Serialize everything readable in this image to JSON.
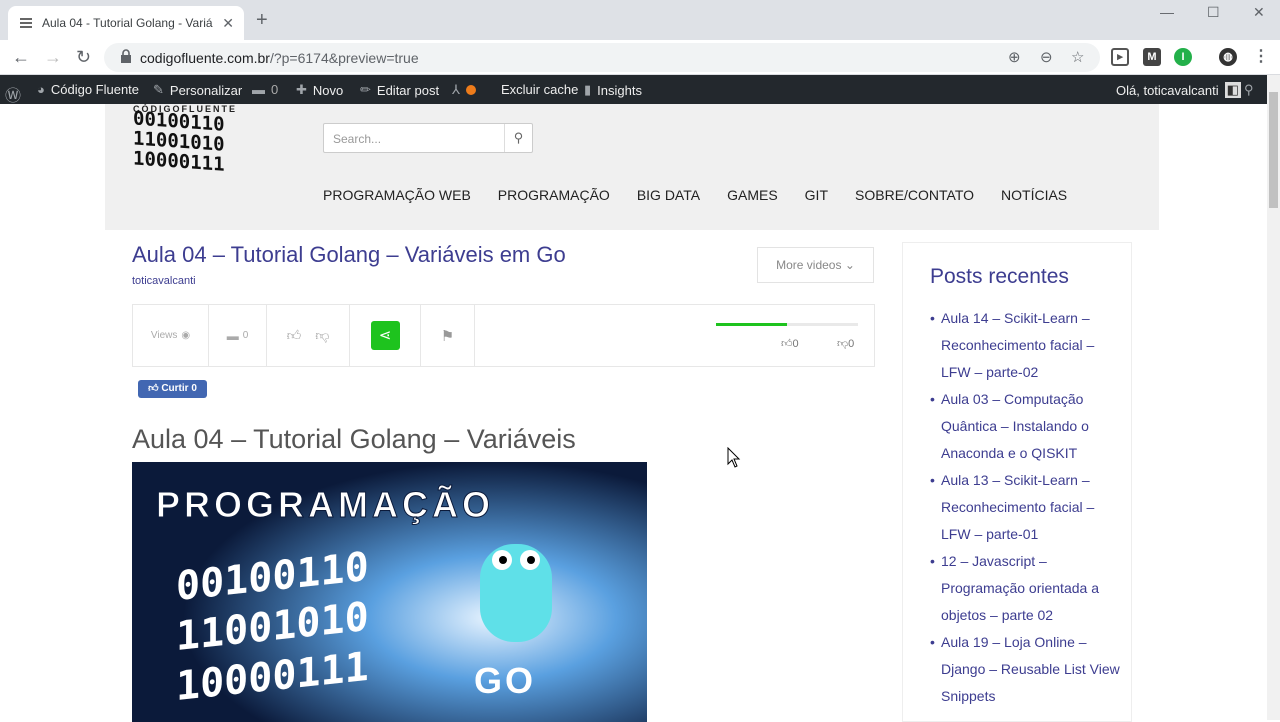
{
  "browser": {
    "tab_title": "Aula 04 - Tutorial Golang - Variá",
    "url_domain": "codigofluente.com.br",
    "url_path": "/?p=6174&preview=true"
  },
  "wp_admin_bar": {
    "site_name": "Código Fluente",
    "customize": "Personalizar",
    "comments_count": "0",
    "new": "Novo",
    "edit_post": "Editar post",
    "clear_cache": "Excluir cache",
    "insights": "Insights",
    "greeting": "Olá, toticavalcanti"
  },
  "site": {
    "logo_text": "CÓDIGOFLUENTE",
    "logo_bits": [
      "00100110",
      "11001010",
      "10000111"
    ],
    "search_placeholder": "Search...",
    "menu": [
      "PROGRAMAÇÃO WEB",
      "PROGRAMAÇÃO",
      "BIG DATA",
      "GAMES",
      "GIT",
      "SOBRE/CONTATO",
      "NOTÍCIAS"
    ]
  },
  "video": {
    "title": "Aula 04 – Tutorial Golang – Variáveis em Go",
    "author": "toticavalcanti",
    "more_videos": "More videos",
    "views_label": "Views",
    "comments": "0",
    "likes": "0",
    "dislikes": "0",
    "like_ratio": 0.5,
    "fb_like": "Curtir 0"
  },
  "post": {
    "title": "Aula 04 – Tutorial Golang – Variáveis",
    "hero_heading": "PROGRAMAÇÃO",
    "hero_bits": [
      "00100110",
      "11001010",
      "10000111"
    ],
    "hero_go": "GO"
  },
  "sidebar": {
    "heading": "Posts recentes",
    "posts": [
      "Aula 14 – Scikit-Learn – Reconhecimento facial – LFW – parte-02",
      "Aula 03 – Computação Quântica – Instalando o Anaconda e o QISKIT",
      "Aula 13 – Scikit-Learn – Reconhecimento facial – LFW – parte-01",
      "12 – Javascript – Programação orientada a objetos – parte 02",
      "Aula 19 – Loja Online – Django – Reusable List View Snippets"
    ]
  },
  "colors": {
    "accent": "#3d3d90",
    "share_green": "#1ec31e",
    "wp_bar": "#23282d"
  }
}
